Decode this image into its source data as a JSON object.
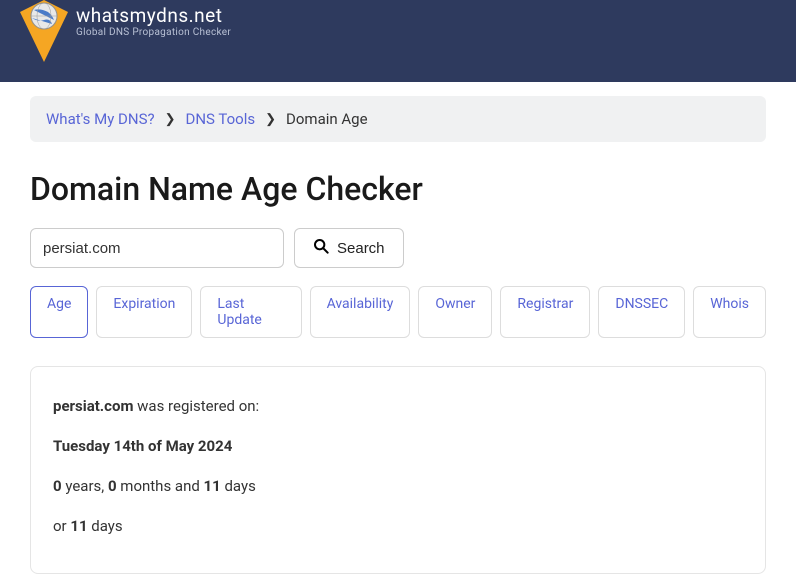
{
  "header": {
    "site_title": "whatsmydns.net",
    "site_subtitle": "Global DNS Propagation Checker"
  },
  "breadcrumb": {
    "home": "What's My DNS?",
    "tools": "DNS Tools",
    "current": "Domain Age"
  },
  "page": {
    "title": "Domain Name Age Checker"
  },
  "search": {
    "domain_value": "persiat.com",
    "button_label": "Search"
  },
  "tabs": {
    "age": "Age",
    "expiration": "Expiration",
    "last_update": "Last Update",
    "availability": "Availability",
    "owner": "Owner",
    "registrar": "Registrar",
    "dnssec": "DNSSEC",
    "whois": "Whois"
  },
  "result": {
    "domain": "persiat.com",
    "registered_on_text": " was registered on:",
    "registration_date": "Tuesday 14th of May 2024",
    "years": "0",
    "years_label": " years, ",
    "months": "0",
    "months_label": " months and ",
    "days": "11",
    "days_label": " days",
    "or_label": "or ",
    "total_days": "11",
    "total_days_label": " days"
  }
}
